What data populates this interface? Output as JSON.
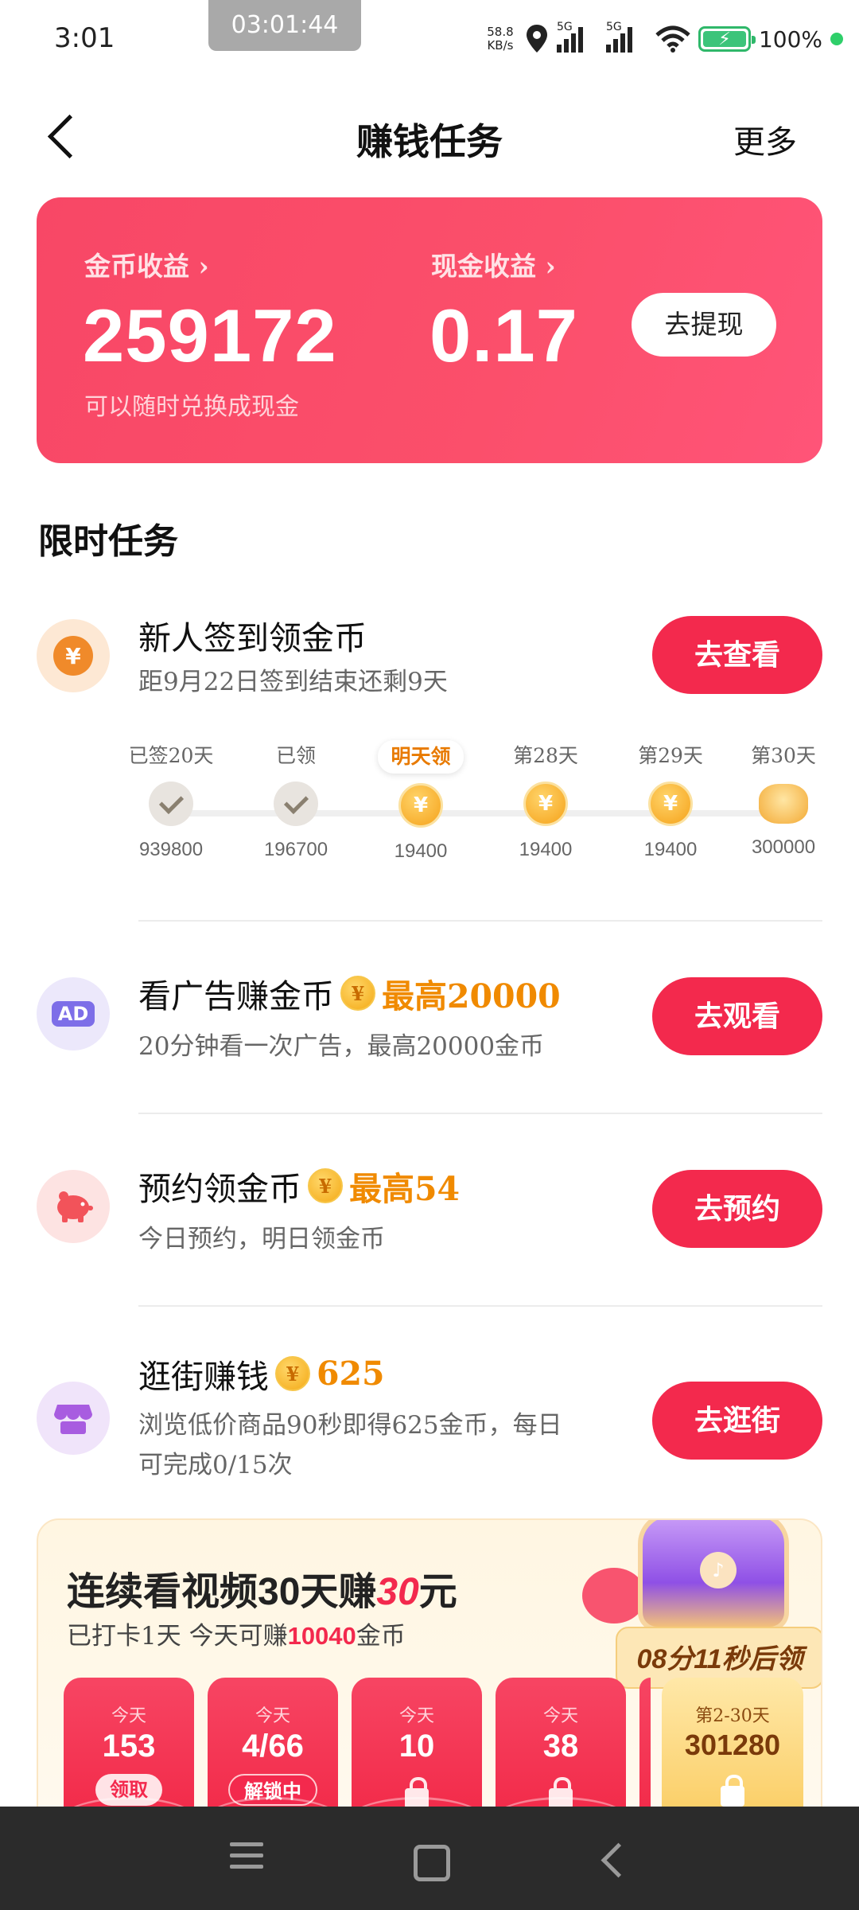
{
  "status_bar": {
    "time": "3:01",
    "recording_time": "03:01:44",
    "net_speed_value": "58.8",
    "net_speed_unit": "KB/s",
    "signal_1_label": "5G",
    "signal_2_label": "5G",
    "battery": "100%",
    "icons": [
      "location-icon",
      "signal-icon",
      "wifi-icon",
      "battery-charging-icon"
    ]
  },
  "header": {
    "title": "赚钱任务",
    "more": "更多"
  },
  "earnings": {
    "coin_label": "金币收益 ›",
    "coin_value": "259172",
    "cash_label": "现金收益 ›",
    "cash_value": "0.17",
    "hint": "可以随时兑换成现金",
    "withdraw_button": "去提现",
    "colors": {
      "card_start": "#f84766",
      "card_end": "#ff5478"
    }
  },
  "section_title": "限时任务",
  "tasks": {
    "checkin": {
      "icon": "¥",
      "title": "新人签到领金币",
      "desc": "距9月22日签到结束还剩9天",
      "button": "去查看",
      "days": [
        {
          "label": "已签20天",
          "amount": "939800",
          "state": "done"
        },
        {
          "label": "已领",
          "amount": "196700",
          "state": "done"
        },
        {
          "label": "明天领",
          "amount": "19400",
          "state": "tomorrow"
        },
        {
          "label": "第28天",
          "amount": "19400",
          "state": "coin"
        },
        {
          "label": "第29天",
          "amount": "19400",
          "state": "coin"
        },
        {
          "label": "第30天",
          "amount": "300000",
          "state": "pile"
        }
      ]
    },
    "ad": {
      "icon": "AD",
      "title": "看广告赚金币",
      "reward": "最高20000",
      "desc": "20分钟看一次广告，最高20000金币",
      "button": "去观看"
    },
    "reserve": {
      "icon": "piggy-bank-icon",
      "title": "预约领金币",
      "reward": "最高54",
      "desc": "今日预约，明日领金币",
      "button": "去预约"
    },
    "shop": {
      "icon": "shop-icon",
      "title": "逛街赚钱",
      "reward": "625",
      "desc_line1": "浏览低价商品90秒即得625金币，每日",
      "desc_line2": "可完成0/15次",
      "button": "去逛街"
    },
    "coin_symbol": "¥"
  },
  "promo": {
    "title_a": "连续看视频30天赚",
    "title_hl": "30",
    "title_b": "元",
    "sub_a": "已打卡1天  今天可赚",
    "sub_hl": "10040",
    "sub_b": "金币",
    "countdown": "08分11秒后领",
    "cards": [
      {
        "day": "今天",
        "value": "153",
        "tag": "领取"
      },
      {
        "day": "今天",
        "value": "4/66",
        "tag": "解锁中"
      },
      {
        "day": "今天",
        "value": "10"
      },
      {
        "day": "今天",
        "value": "38"
      }
    ],
    "gold_card": {
      "day": "第2-30天",
      "value": "301280"
    }
  },
  "nav": {
    "icons": [
      "menu-icon",
      "home-icon",
      "back-icon"
    ]
  }
}
